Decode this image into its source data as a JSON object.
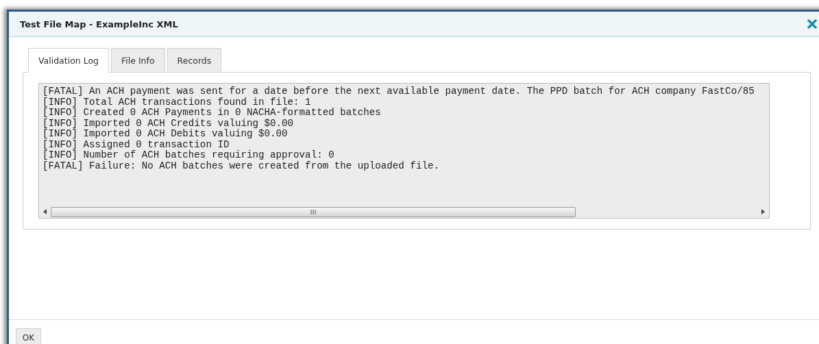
{
  "dialog": {
    "title": "Test File Map - ExampleInc XML"
  },
  "tabs": [
    {
      "label": "Validation Log",
      "selected": true
    },
    {
      "label": "File Info",
      "selected": false
    },
    {
      "label": "Records",
      "selected": false
    }
  ],
  "log_lines": [
    "[FATAL] An ACH payment was sent for a date before the next available payment date. The PPD batch for ACH company FastCo/85",
    "[INFO] Total ACH transactions found in file: 1",
    "[INFO] Created 0 ACH Payments in 0 NACHA-formatted batches",
    "[INFO] Imported 0 ACH Credits valuing $0.00",
    "[INFO] Imported 0 ACH Debits valuing $0.00",
    "[INFO] Assigned 0 transaction ID",
    "[INFO] Number of ACH batches requiring approval: 0",
    "[FATAL] Failure: No ACH batches were created from the uploaded file."
  ],
  "buttons": [
    "OK"
  ]
}
